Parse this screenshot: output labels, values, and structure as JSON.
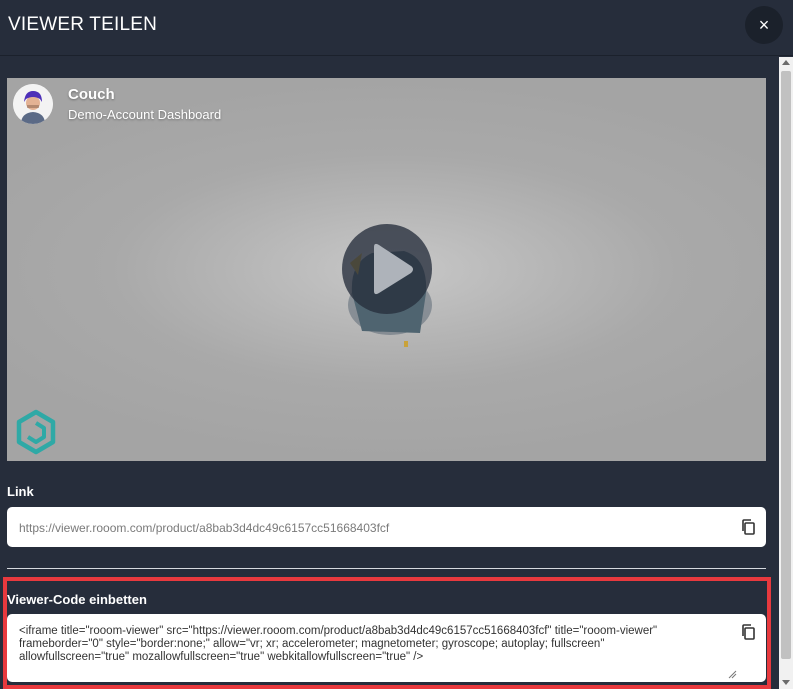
{
  "modal": {
    "title": "VIEWER TEILEN",
    "close_label": "×"
  },
  "preview": {
    "author_name": "Couch",
    "author_subtitle": "Demo-Account Dashboard",
    "play_icon": "play-icon",
    "brand_icon": "rooom-logo-icon"
  },
  "link": {
    "label": "Link",
    "url": "https://viewer.rooom.com/product/a8bab3d4dc49c6157cc51668403fcf",
    "copy_icon": "copy-icon"
  },
  "embed": {
    "label": "Viewer-Code einbetten",
    "code": "<iframe title=\"rooom-viewer\" src=\"https://viewer.rooom.com/product/a8bab3d4dc49c6157cc51668403fcf\" title=\"rooom-viewer\"\nframeborder=\"0\" style=\"border:none;\" allow=\"vr; xr; accelerometer; magnetometer; gyroscope; autoplay; fullscreen\"\nallowfullscreen=\"true\" mozallowfullscreen=\"true\" webkitallowfullscreen=\"true\" />",
    "copy_icon": "copy-icon"
  },
  "colors": {
    "background": "#262d3b",
    "highlight": "#e8393e",
    "brand": "#2fa9a6"
  }
}
